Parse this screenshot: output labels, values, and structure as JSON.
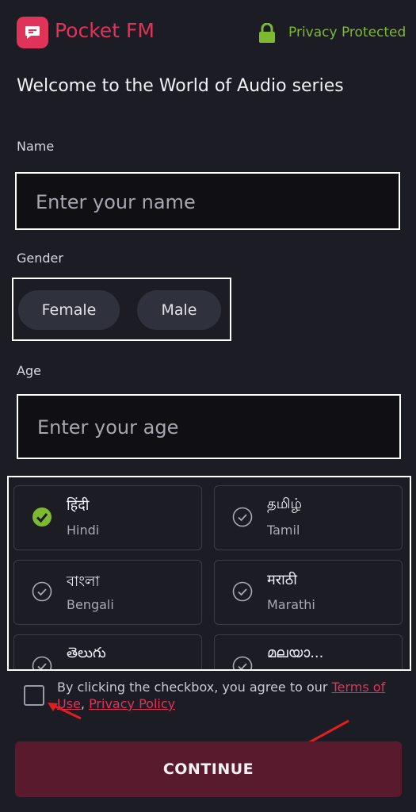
{
  "header": {
    "brand": "Pocket FM",
    "privacy_label": "Privacy Protected",
    "logo_icon": "chat-bubble-icon",
    "lock_icon": "lock-icon"
  },
  "welcome": "Welcome to the World of Audio series",
  "name_field": {
    "label": "Name",
    "placeholder": "Enter your name",
    "value": ""
  },
  "gender": {
    "label": "Gender",
    "options": [
      "Female",
      "Male"
    ]
  },
  "age_field": {
    "label": "Age",
    "placeholder": "Enter your age",
    "value": ""
  },
  "languages": [
    {
      "native": "हिंदी",
      "english": "Hindi",
      "selected": true
    },
    {
      "native": "தமிழ்",
      "english": "Tamil",
      "selected": false
    },
    {
      "native": "বাংলা",
      "english": "Bengali",
      "selected": false
    },
    {
      "native": "मराठी",
      "english": "Marathi",
      "selected": false
    },
    {
      "native": "తెలుగు",
      "english": "",
      "selected": false
    },
    {
      "native": "മലയാ...",
      "english": "",
      "selected": false
    }
  ],
  "agreement": {
    "text": "By clicking the checkbox, you agree to our ",
    "terms": "Terms of Use",
    "separator": ", ",
    "privacy": "Privacy Policy",
    "checked": false
  },
  "continue_label": "CONTINUE",
  "colors": {
    "background": "#1b1c24",
    "brand": "#e0335a",
    "privacy_green": "#7dba2f",
    "continue_bg": "#5a1a2e",
    "annotation_red": "#e02020"
  }
}
